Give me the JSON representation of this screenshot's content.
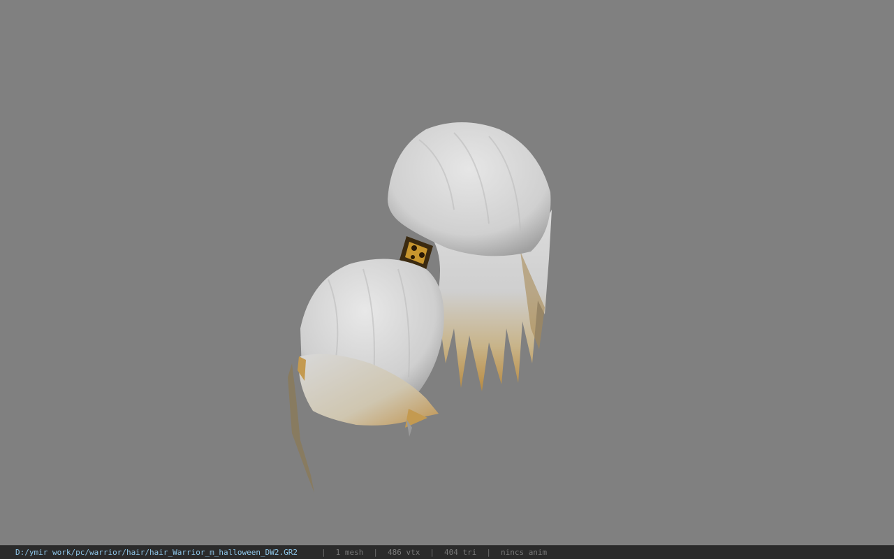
{
  "viewer": {
    "background_color": "#808080",
    "model": {
      "name": "hair-model",
      "hair_color": "#d9d9d9",
      "tip_color": "#c49a50",
      "band_color": "#3b2a10"
    }
  },
  "statusbar": {
    "file_path": "D:/ymir work/pc/warrior/hair/hair_Warrior_m_halloween_DW2.GR2",
    "separator": "|",
    "mesh_count": "1 mesh",
    "vertex_count": "486 vtx",
    "triangle_count": "404 tri",
    "anim_status": "nincs anim"
  }
}
